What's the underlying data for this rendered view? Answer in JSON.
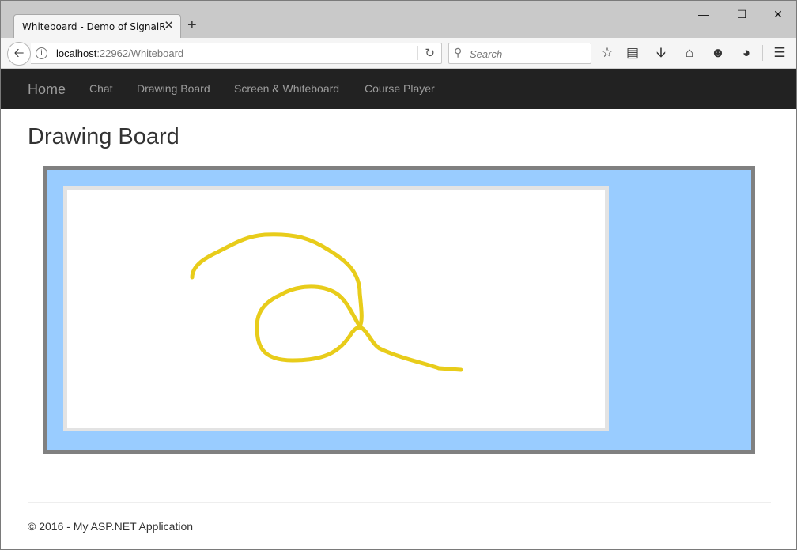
{
  "browser": {
    "tab_title": "Whiteboard - Demo of SignalR",
    "tab_close": "✕",
    "new_tab": "+",
    "window_controls": {
      "minimize": "—",
      "maximize": "☐",
      "close": "✕"
    },
    "url_host": "localhost",
    "url_rest": ":22962/Whiteboard",
    "search_placeholder": "Search",
    "toolbar_icons": [
      "star-icon",
      "reading-list-icon",
      "download-icon",
      "home-icon",
      "smiley-icon",
      "pocket-icon",
      "menu-icon"
    ]
  },
  "navbar": {
    "brand": "Home",
    "links": [
      "Chat",
      "Drawing Board",
      "Screen & Whiteboard",
      "Course Player"
    ]
  },
  "main": {
    "title": "Drawing Board",
    "board": {
      "frame_color": "#808080",
      "background_color": "#99ccff",
      "canvas_color": "#ffffff",
      "stroke_color": "#e8cc1a"
    }
  },
  "footer": {
    "text": "© 2016 - My ASP.NET Application"
  }
}
